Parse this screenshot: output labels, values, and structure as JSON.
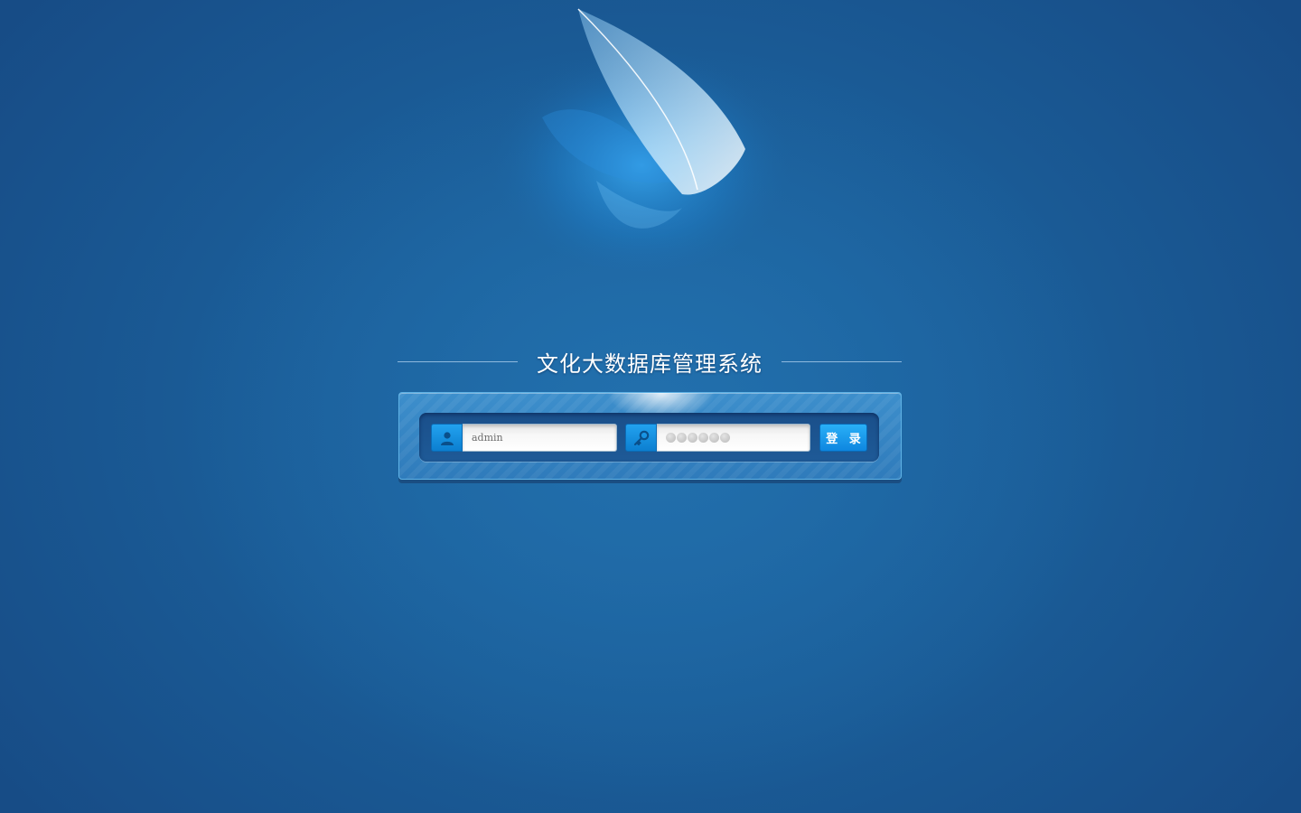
{
  "page": {
    "title": "文化大数据库管理系统"
  },
  "login": {
    "username": {
      "value": "admin",
      "icon": "user-icon"
    },
    "password": {
      "masked_value": "●●●●●●",
      "dot_count": 6,
      "icon": "key-icon"
    },
    "submit_label": "登 录"
  },
  "theme": {
    "background": "#1d66a3",
    "accent": "#0e86e0",
    "panel": "#2f7bbb"
  },
  "decor": {
    "background_art": "feather-icon"
  }
}
